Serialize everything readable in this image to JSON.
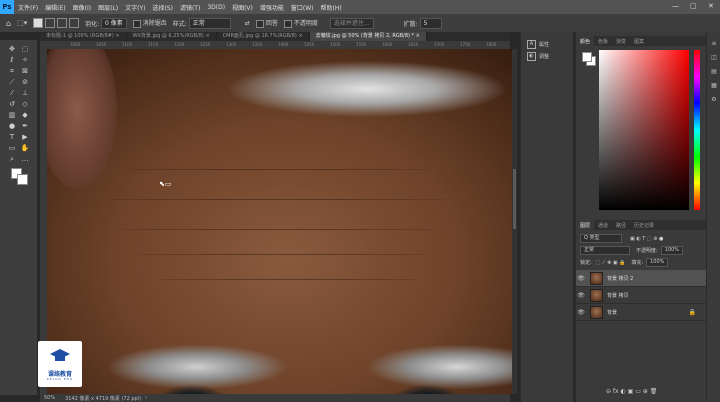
{
  "app": {
    "logo": "Ps",
    "brand_color": "#31a8ff"
  },
  "menu": [
    "文件(F)",
    "编辑(E)",
    "图像(I)",
    "图层(L)",
    "文字(Y)",
    "选择(S)",
    "滤镜(T)",
    "3D(D)",
    "视图(V)",
    "增强功能",
    "窗口(W)",
    "帮助(H)"
  ],
  "window_controls": {
    "minimize": "—",
    "restore": "▢",
    "close": "✕"
  },
  "options": {
    "feather_label": "羽化:",
    "feather_value": "0 像素",
    "antialias_label": "消除锯齿",
    "style_label": "样式:",
    "style_value": "正常",
    "width_label": "宽度:",
    "height_label": "高度:",
    "select_mask_label": "选择并遮住...",
    "mode_value": "正常",
    "anti_label": "回答",
    "opacity_label": "不透明度",
    "expand_label": "扩散:",
    "expand_value": "5"
  },
  "tabs": [
    {
      "label": "未标题-1 @ 100% (RGB/8#) ×",
      "active": false
    },
    {
      "label": "WX背景.jpg @ 6.25%(RGB/8) ×",
      "active": false
    },
    {
      "label": "CMR面孔.jpg @ 16.7%(RGB/8) ×",
      "active": false
    },
    {
      "label": "去皱纹.jpg @ 50% (背景 拷贝 2, RGB/8) * ×",
      "active": true
    }
  ],
  "ruler_ticks": [
    "1000",
    "1050",
    "1100",
    "1150",
    "1200",
    "1250",
    "1300",
    "1350",
    "1400",
    "1450",
    "1500",
    "1550",
    "1600",
    "1650",
    "1700",
    "1750",
    "1800"
  ],
  "status": {
    "zoom": "50%",
    "doc_info": "3142 像素 x 4719 像素 (72 ppi)"
  },
  "watermark": {
    "name": "课络教育",
    "sub": "KELUO EDU"
  },
  "mini_panel": [
    {
      "icon": "A",
      "label": "属性"
    },
    {
      "icon": "◐",
      "label": "调整"
    }
  ],
  "color_panel": {
    "tabs": [
      "颜色",
      "色板",
      "渐变",
      "图案"
    ],
    "fg": "#ffffff",
    "bg": "#ffffff"
  },
  "layers_panel": {
    "tabs": [
      "图层",
      "通道",
      "路径",
      "历史记录"
    ],
    "filter_label": "Q 类型",
    "blend_mode": "正常",
    "opacity_label": "不透明度:",
    "opacity_value": "100%",
    "lock_label": "锁定:",
    "fill_label": "填充:",
    "fill_value": "100%",
    "layers": [
      {
        "name": "背景 拷贝 2",
        "selected": true,
        "locked": false
      },
      {
        "name": "背景 拷贝",
        "selected": false,
        "locked": false
      },
      {
        "name": "背景",
        "selected": false,
        "locked": true
      }
    ]
  },
  "far_right_icons": [
    "≡",
    "◫",
    "▤",
    "▦",
    "⚙"
  ]
}
